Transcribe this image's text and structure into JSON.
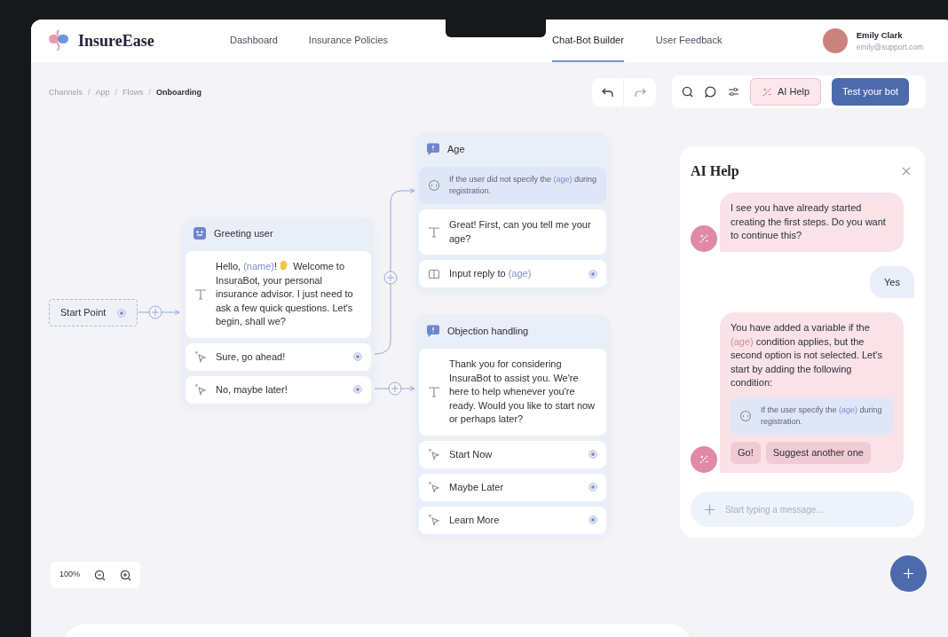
{
  "app": {
    "logo": "InsureEase"
  },
  "nav": [
    {
      "label": "Dashboard",
      "selected": false
    },
    {
      "label": "Insurance Policies",
      "selected": false
    },
    {
      "label": "Chat-Bot Builder",
      "selected": true
    },
    {
      "label": "User Feedback",
      "selected": false
    }
  ],
  "user": {
    "name": "Emily Clark",
    "email": "emily@support.com"
  },
  "breadcrumb": [
    {
      "label": "Channels",
      "current": false
    },
    {
      "separator": "/",
      "label": "App",
      "current": false
    },
    {
      "separator": "/",
      "label": "Flows",
      "current": false
    },
    {
      "separator": "/",
      "label": "Onboarding",
      "current": true
    }
  ],
  "toolbar": {
    "ai_help": "AI Help",
    "test_button": "Test your bot"
  },
  "start_node": {
    "label": "Start Point"
  },
  "nodes": [
    {
      "title": "Greeting user",
      "items": [
        {
          "kind": "message",
          "segments": [
            {
              "text": "Hello, "
            },
            {
              "text": "(name)",
              "kind": "variable"
            },
            {
              "text": "!"
            },
            {
              "kind": "wave_icon"
            },
            {
              "text": " Welcome to InsuraBot, your personal insurance advisor. I just need to ask a few quick questions. Let's begin, shall we?"
            }
          ]
        },
        {
          "kind": "choice",
          "segments": [
            {
              "text": "Sure, go ahead!"
            }
          ]
        },
        {
          "kind": "choice",
          "segments": [
            {
              "text": "No, maybe later!"
            }
          ]
        }
      ]
    },
    {
      "title": "Age",
      "items": [
        {
          "kind": "condition",
          "segments": [
            {
              "text": "If the user did not specify the "
            },
            {
              "text": "(age)",
              "kind": "variable"
            },
            {
              "text": " during registration."
            }
          ]
        },
        {
          "kind": "message",
          "segments": [
            {
              "text": "Great! First, can you tell me your age?"
            }
          ]
        },
        {
          "kind": "input",
          "segments": [
            {
              "text": "Input reply to "
            },
            {
              "text": "(age)",
              "kind": "variable"
            }
          ]
        }
      ]
    },
    {
      "title": "Objection handling",
      "items": [
        {
          "kind": "message",
          "segments": [
            {
              "text": "Thank you for considering InsuraBot to assist you. We're here to help whenever you're ready. Would you like to start now or perhaps later?"
            }
          ]
        },
        {
          "kind": "choice",
          "segments": [
            {
              "text": "Start Now"
            }
          ]
        },
        {
          "kind": "choice",
          "segments": [
            {
              "text": "Maybe Later"
            }
          ]
        },
        {
          "kind": "choice",
          "segments": [
            {
              "text": "Learn More"
            }
          ]
        }
      ]
    }
  ],
  "chat": {
    "title": "AI Help",
    "messages": [
      {
        "kind": "assistant",
        "segments": [
          {
            "text": "I see you have already started creating the first steps. Do you want to continue this?"
          }
        ]
      },
      {
        "kind": "user",
        "segments": [
          {
            "text": "Yes"
          }
        ]
      },
      {
        "kind": "assistant",
        "segments": [
          {
            "text": "You have added a variable if the "
          },
          {
            "text": "(age)",
            "kind": "variable"
          },
          {
            "text": " condition applies, but the second option is not selected. Let's start by adding the following condition:"
          }
        ],
        "condition": [
          {
            "text": "If the user specify the "
          },
          {
            "text": "(age)",
            "kind": "variable"
          },
          {
            "text": " during registration."
          }
        ],
        "actions": [
          "Go!",
          "Suggest another one"
        ]
      }
    ],
    "placeholder": "Start typing a message..."
  },
  "zoom": {
    "reading": "100%"
  }
}
